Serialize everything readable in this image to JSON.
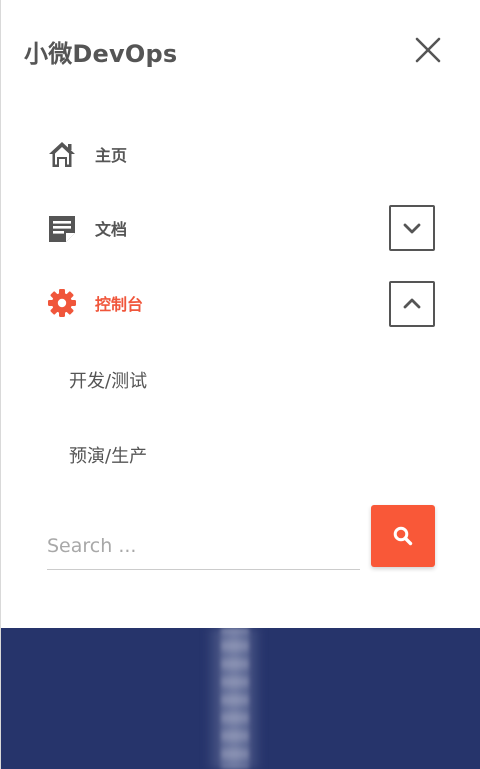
{
  "header": {
    "site_title": "小微DevOps"
  },
  "nav": {
    "items": [
      {
        "label": "主页",
        "icon": "home-icon"
      },
      {
        "label": "文档",
        "icon": "document-icon",
        "expanded": false
      },
      {
        "label": "控制台",
        "icon": "gear-icon",
        "expanded": true
      }
    ],
    "sub_items": [
      {
        "label": "开发/测试"
      },
      {
        "label": "预演/生产"
      }
    ]
  },
  "search": {
    "placeholder": "Search ..."
  },
  "colors": {
    "accent": "#f95838",
    "text": "#555555",
    "hero_bg": "#26346b"
  }
}
